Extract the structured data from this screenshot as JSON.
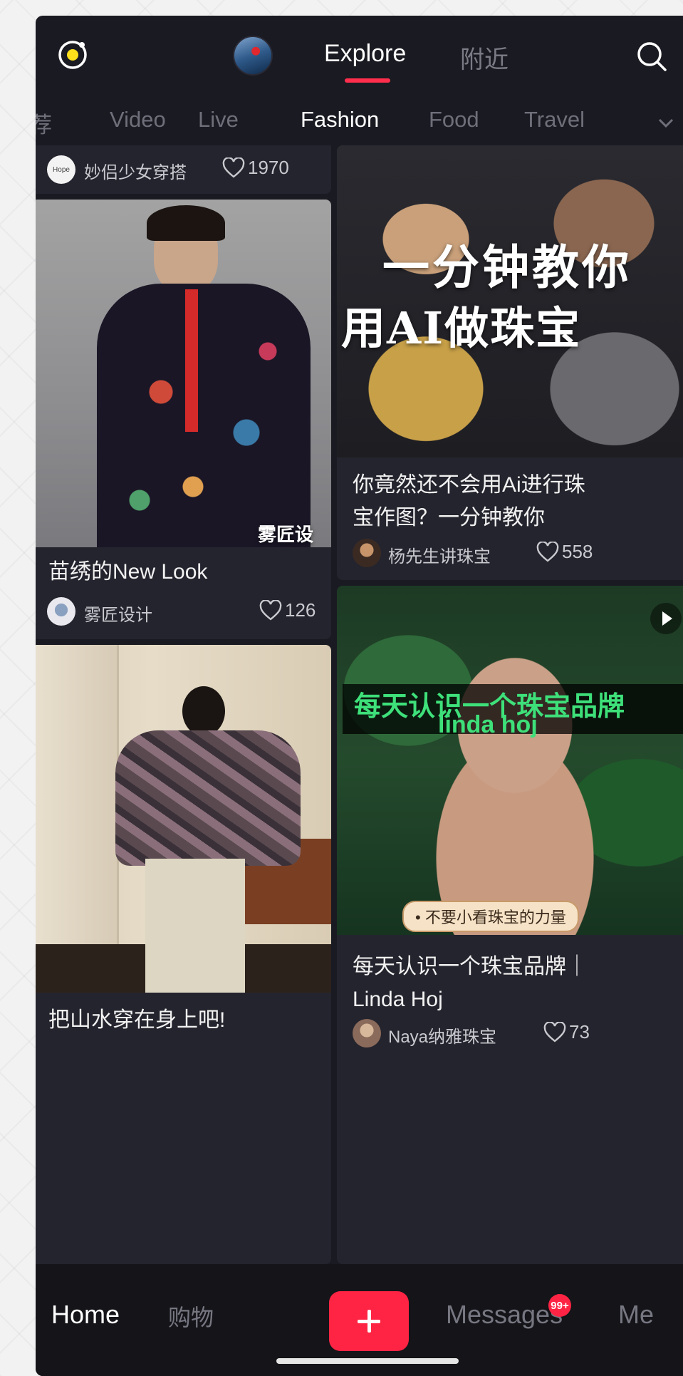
{
  "header": {
    "tabs": [
      "Explore",
      "附近"
    ],
    "active_tab": "Explore",
    "icons": [
      "camera-icon",
      "search-icon"
    ]
  },
  "categories": {
    "items": [
      "荐",
      "Video",
      "Live",
      "Fashion",
      "Food",
      "Travel"
    ],
    "active": "Fashion"
  },
  "feed": {
    "left": [
      {
        "author": "妙侣少女穿搭",
        "author_avatar_text": "Hope",
        "likes": "1970"
      },
      {
        "title": "苗绣的New Look",
        "author": "雾匠设计",
        "likes": "126",
        "watermark": "雾匠设计"
      },
      {
        "title": "把山水穿在身上吧!"
      }
    ],
    "right": [
      {
        "image_text": [
          "一分钟教你",
          "用AI做珠宝"
        ],
        "title_lines": [
          "你竟然还不会用Ai进行珠",
          "宝作图？一分钟教你"
        ],
        "author": "杨先生讲珠宝",
        "likes": "558"
      },
      {
        "image_text": [
          "每天认识一个珠宝品牌",
          "linda hoj"
        ],
        "pill": "• 不要小看珠宝的力量",
        "title_lines": [
          "每天认识一个珠宝品牌｜",
          "Linda Hoj"
        ],
        "author": "Naya纳雅珠宝",
        "likes": "73",
        "is_video": true
      }
    ]
  },
  "bottom_nav": {
    "home": "Home",
    "shop": "购物",
    "messages": "Messages",
    "messages_badge": "99+",
    "me": "Me"
  },
  "colors": {
    "accent": "#ff2443",
    "background": "#1a1a22",
    "card": "#24242e"
  }
}
